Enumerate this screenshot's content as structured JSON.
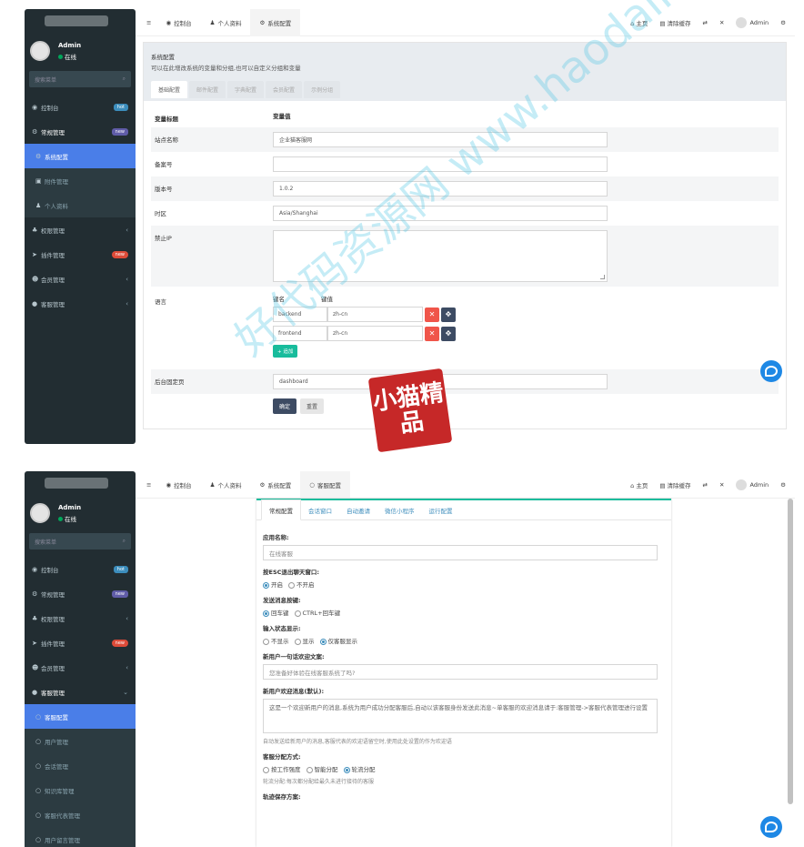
{
  "screen1": {
    "user": {
      "name": "Admin",
      "status": "在线"
    },
    "search_placeholder": "搜索菜单",
    "menu": [
      {
        "label": "控制台",
        "badge": "hot"
      },
      {
        "label": "常规管理",
        "badge": "new"
      },
      {
        "label": "系统配置",
        "active": true
      },
      {
        "label": "附件管理"
      },
      {
        "label": "个人资料"
      },
      {
        "label": "权限管理"
      },
      {
        "label": "插件管理",
        "badge": "new"
      },
      {
        "label": "会员管理"
      },
      {
        "label": "客服管理"
      }
    ],
    "topbar": {
      "tabs": [
        "控制台",
        "个人资料",
        "系统配置"
      ],
      "home": "主页",
      "clear_cache": "清除缓存",
      "user": "Admin"
    },
    "page": {
      "title": "系统配置",
      "subtitle": "可以在此增改系统的变量和分组,也可以自定义分组和变量",
      "tabs": [
        "基础配置",
        "邮件配置",
        "字典配置",
        "会员配置",
        "示例分组"
      ],
      "col_name": "变量标题",
      "col_value": "变量值",
      "rows": {
        "site_name": {
          "label": "站点名称",
          "value": "企业猫客服网"
        },
        "beian": {
          "label": "备案号",
          "value": ""
        },
        "version": {
          "label": "版本号",
          "value": "1.0.2"
        },
        "timezone": {
          "label": "时区",
          "value": "Asia/Shanghai"
        },
        "forbidden_ip": {
          "label": "禁止IP",
          "value": ""
        },
        "language": {
          "label": "语言",
          "key_header": "键名",
          "value_header": "键值",
          "pairs": [
            {
              "key": "backend",
              "value": "zh-cn"
            },
            {
              "key": "frontend",
              "value": "zh-cn"
            }
          ],
          "add_label": "追加"
        },
        "fixed_page": {
          "label": "后台固定页",
          "value": "dashboard"
        }
      },
      "submit": "确定",
      "reset": "重置"
    }
  },
  "screen2": {
    "user": {
      "name": "Admin",
      "status": "在线"
    },
    "search_placeholder": "搜索菜单",
    "menu": [
      {
        "label": "控制台",
        "badge": "hot"
      },
      {
        "label": "常规管理",
        "badge": "new"
      },
      {
        "label": "权限管理"
      },
      {
        "label": "插件管理",
        "badge": "new"
      },
      {
        "label": "会员管理"
      },
      {
        "label": "客服管理"
      },
      {
        "label": "客服配置",
        "active": true
      },
      {
        "label": "用户管理"
      },
      {
        "label": "会话管理"
      },
      {
        "label": "知识库管理"
      },
      {
        "label": "客服代表管理"
      },
      {
        "label": "用户留言管理"
      }
    ],
    "topbar": {
      "tabs": [
        "控制台",
        "个人资料",
        "系统配置",
        "客服配置"
      ],
      "home": "主页",
      "clear_cache": "清除缓存",
      "user": "Admin"
    },
    "page": {
      "tabs": [
        "常规配置",
        "会话窗口",
        "自动邀请",
        "微信小程序",
        "运行配置"
      ],
      "app_name_label": "应用名称:",
      "app_name_value": "在线客服",
      "esc_label": "按ESC退出聊天窗口:",
      "esc_options": [
        "开启",
        "不开启"
      ],
      "send_key_label": "发送消息按键:",
      "send_key_options": [
        "回车键",
        "CTRL+回车键"
      ],
      "typing_label": "输入状态显示:",
      "typing_options": [
        "不显示",
        "显示",
        "仅客服显示"
      ],
      "welcome_label": "新用户一句话欢迎文案:",
      "welcome_value": "您准备好体验在线客服系统了吗?",
      "welcome_msg_label": "新用户欢迎消息(默认):",
      "welcome_msg_value": "这是一个欢迎新用户的消息,系统为用户成功分配客服后,自动以该客服身份发送此消息~单客服的欢迎消息请于:客服管理->客服代表管理进行设置",
      "welcome_msg_help": "自动发送给新用户的消息,客服代表的欢迎语留空时,使用此处设置的作为欢迎语",
      "assign_label": "客服分配方式:",
      "assign_options": [
        "按工作强度",
        "智能分配",
        "轮流分配"
      ],
      "assign_help": "轮流分配:每次都分配给最久未进行接待的客服",
      "track_label": "轨迹保存方案:"
    }
  },
  "watermark": {
    "text": "好代码资源网 www.haodaima.cc",
    "stamp": "小猫精品"
  }
}
